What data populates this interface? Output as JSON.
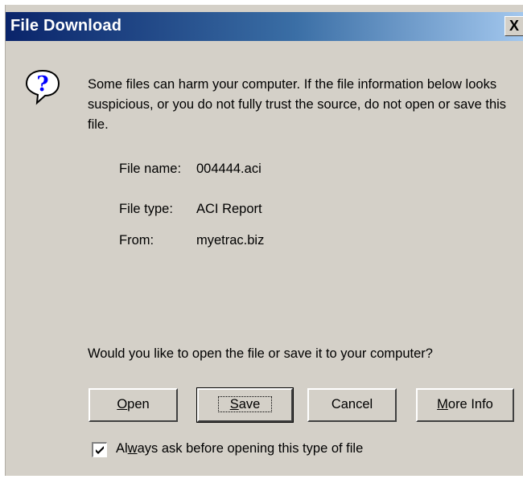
{
  "window": {
    "title": "File Download",
    "close_label": "X"
  },
  "icon": "question-icon",
  "message": "Some files can harm your computer. If the file information below looks suspicious, or you do not fully trust the source, do not open or save this file.",
  "file_info": [
    {
      "label": "File name:",
      "value": "004444.aci"
    },
    {
      "label": "File type:",
      "value": "ACI Report"
    },
    {
      "label": "From:",
      "value": "myetrac.biz"
    }
  ],
  "question": "Would you like to open the file or save it to your computer?",
  "buttons": {
    "open": {
      "mnemonic": "O",
      "rest": "pen"
    },
    "save": {
      "mnemonic": "S",
      "rest": "ave"
    },
    "cancel": {
      "label": "Cancel"
    },
    "more_info": {
      "mnemonic": "M",
      "rest": "ore Info"
    }
  },
  "checkbox": {
    "checked": true,
    "label_pre": "Al",
    "mnemonic": "w",
    "label_post": "ays ask before opening this type of file"
  }
}
